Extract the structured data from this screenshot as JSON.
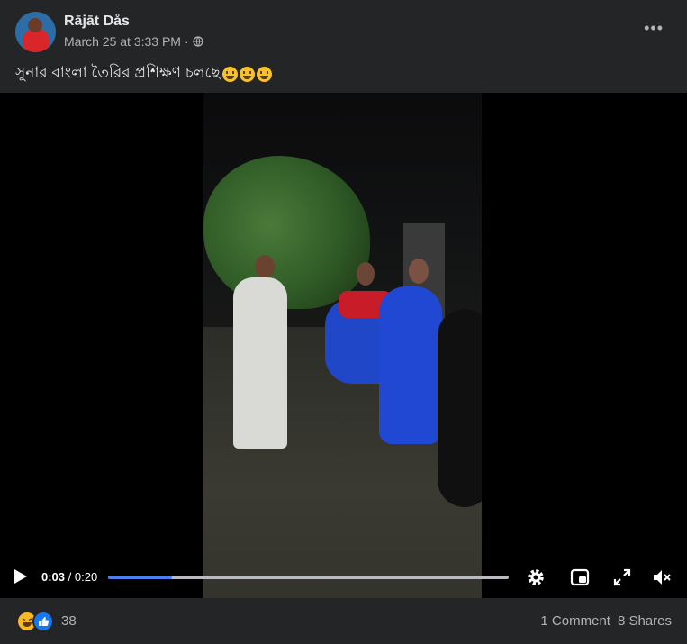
{
  "post": {
    "author": "Rājāt Dås",
    "date": "March 25 at 3:33 PM ·",
    "privacy_icon": "globe-icon",
    "menu_icon": "more-options-icon",
    "caption_text": "সুনার বাংলা তৈরির প্রশিক্ষণ চলছে",
    "caption_emojis": [
      "grinning-face-emoji",
      "grinning-face-emoji",
      "grinning-face-emoji"
    ]
  },
  "video": {
    "current_time": "0:03",
    "duration": "/ 0:20",
    "progress_fraction": 0.16,
    "accent_color": "#4a80f0",
    "controls": [
      "play-icon",
      "settings-icon",
      "picture-in-picture-icon",
      "fullscreen-icon",
      "muted-volume-icon"
    ]
  },
  "footer": {
    "reaction_icons": [
      "haha-reaction-icon",
      "like-reaction-icon"
    ],
    "reaction_count": "38",
    "comments": "1 Comment",
    "shares": "8 Shares"
  }
}
